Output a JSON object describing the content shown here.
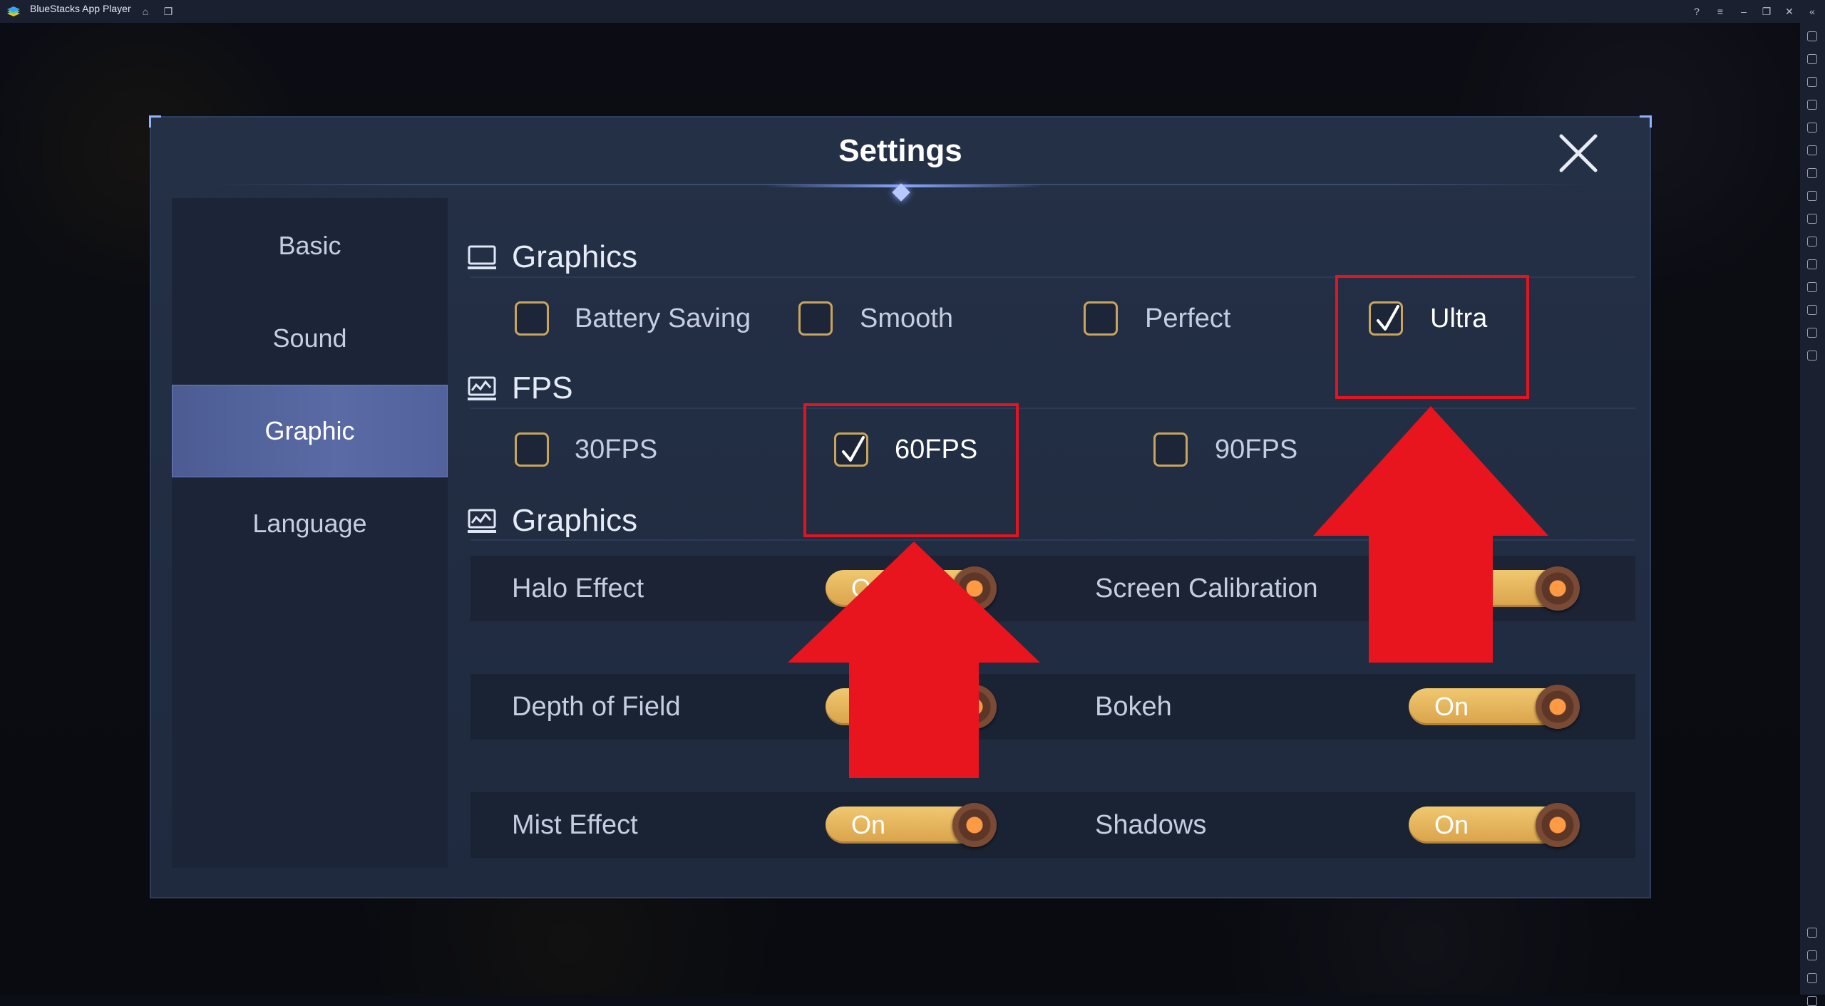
{
  "window": {
    "app_title": "BlueStacks App Player"
  },
  "dialog": {
    "title": "Settings"
  },
  "tabs": [
    {
      "label": "Basic"
    },
    {
      "label": "Sound"
    },
    {
      "label": "Graphic",
      "active": true
    },
    {
      "label": "Language"
    }
  ],
  "graphics_quality": {
    "title": "Graphics",
    "options": [
      {
        "label": "Battery Saving",
        "checked": false
      },
      {
        "label": "Smooth",
        "checked": false
      },
      {
        "label": "Perfect",
        "checked": false
      },
      {
        "label": "Ultra",
        "checked": true
      }
    ]
  },
  "fps": {
    "title": "FPS",
    "options": [
      {
        "label": "30FPS",
        "checked": false
      },
      {
        "label": "60FPS",
        "checked": true
      },
      {
        "label": "90FPS",
        "checked": false
      }
    ]
  },
  "graphics_effects": {
    "title": "Graphics",
    "rows": [
      {
        "left": {
          "label": "Halo Effect",
          "state": "On"
        },
        "right": {
          "label": "Screen Calibration",
          "state": "On"
        }
      },
      {
        "left": {
          "label": "Depth of Field",
          "state": "On"
        },
        "right": {
          "label": "Bokeh",
          "state": "On"
        }
      },
      {
        "left": {
          "label": "Mist Effect",
          "state": "On"
        },
        "right": {
          "label": "Shadows",
          "state": "On"
        }
      }
    ]
  },
  "colors": {
    "accent_gold": "#d9a24a",
    "highlight_red": "#e3141f",
    "active_tab": "#5a6aa4"
  }
}
